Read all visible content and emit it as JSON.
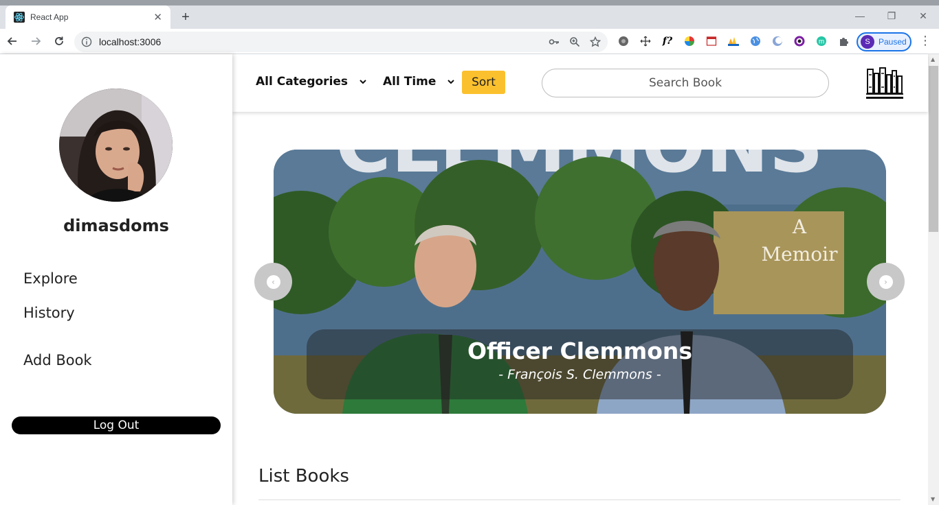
{
  "browser": {
    "tab_title": "React App",
    "tab_close": "✕",
    "new_tab": "+",
    "url": "localhost:3006",
    "profile_initial": "S",
    "profile_status": "Paused",
    "window_minimize": "—",
    "window_restore": "❐",
    "window_close": "✕",
    "ext_func": "f?"
  },
  "sidebar": {
    "username": "dimasdoms",
    "menu": [
      {
        "label": "Explore"
      },
      {
        "label": "History"
      },
      {
        "label": "Add Book"
      }
    ],
    "logout_label": "Log Out"
  },
  "topbar": {
    "category_label": "All Categories",
    "time_label": "All Time",
    "sort_label": "Sort",
    "search_placeholder": "Search Book"
  },
  "carousel": {
    "cover_text_top": "CLEMMONS",
    "cover_text_a": "A",
    "cover_text_memoir": "Memoir",
    "title": "Officer Clemmons",
    "author": "- François S. Clemmons -",
    "prev_glyph": "‹",
    "next_glyph": "›"
  },
  "list": {
    "title": "List Books"
  },
  "colors": {
    "accent": "#fbc02d",
    "logout_bg": "#000000",
    "profile_ring": "#1a73e8"
  }
}
